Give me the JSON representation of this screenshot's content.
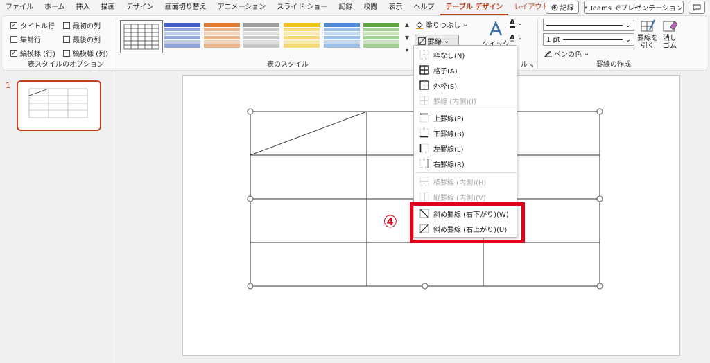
{
  "menu": {
    "tabs": [
      "ファイル",
      "ホーム",
      "挿入",
      "描画",
      "デザイン",
      "画面切り替え",
      "アニメーション",
      "スライド ショー",
      "記録",
      "校閲",
      "表示",
      "ヘルプ"
    ],
    "active_tab": "テーブル デザイン",
    "layout_tab": "レイアウト",
    "record_label": "記録",
    "teams_label": "Teams でプレゼンテーション"
  },
  "ribbon": {
    "options": {
      "title_row": "タイトル行",
      "total_row": "集計行",
      "banded_rows": "縞模様 (行)",
      "first_col": "最初の列",
      "last_col": "最後の列",
      "banded_cols": "縞模様 (列)",
      "group_label": "表スタイルのオプション"
    },
    "styles": {
      "group_label": "表のスタイル",
      "swatch_colors": [
        "#3b5fc0",
        "#e07a30",
        "#a0a0a0",
        "#f2c010",
        "#4a8fd8",
        "#5aab3c"
      ]
    },
    "shading_label": "塗りつぶし",
    "border_label": "罫線",
    "quick_label": "クイック",
    "wordart_group_tail": "ル",
    "line_width": "1 pt",
    "pen_color_label": "ペンの色",
    "draw_table_label": "罫線を\n引く",
    "eraser_label": "消し\nゴム",
    "draw_group_label": "罫線の作成"
  },
  "thumbnail": {
    "slide_number": "1"
  },
  "dropdown": {
    "items": [
      {
        "label": "枠なし(N)",
        "disabled": false,
        "icon": "no-border-icon"
      },
      {
        "label": "格子(A)",
        "disabled": false,
        "icon": "all-borders-icon"
      },
      {
        "label": "外枠(S)",
        "disabled": false,
        "icon": "outside-borders-icon"
      },
      {
        "label": "罫線 (内側)(I)",
        "disabled": true,
        "icon": "inside-borders-icon"
      },
      {
        "label": "上罫線(P)",
        "disabled": false,
        "icon": "top-border-icon"
      },
      {
        "label": "下罫線(B)",
        "disabled": false,
        "icon": "bottom-border-icon"
      },
      {
        "label": "左罫線(L)",
        "disabled": false,
        "icon": "left-border-icon"
      },
      {
        "label": "右罫線(R)",
        "disabled": false,
        "icon": "right-border-icon"
      },
      {
        "label": "横罫線 (内側)(H)",
        "disabled": true,
        "icon": "inside-horizontal-border-icon"
      },
      {
        "label": "縦罫線 (内側)(V)",
        "disabled": true,
        "icon": "inside-vertical-border-icon"
      },
      {
        "label": "斜め罫線 (右下がり)(W)",
        "disabled": false,
        "icon": "diagonal-down-border-icon"
      },
      {
        "label": "斜め罫線 (右上がり)(U)",
        "disabled": false,
        "icon": "diagonal-up-border-icon"
      }
    ]
  },
  "annotation": {
    "step": "④",
    "color": "#e0001a"
  }
}
